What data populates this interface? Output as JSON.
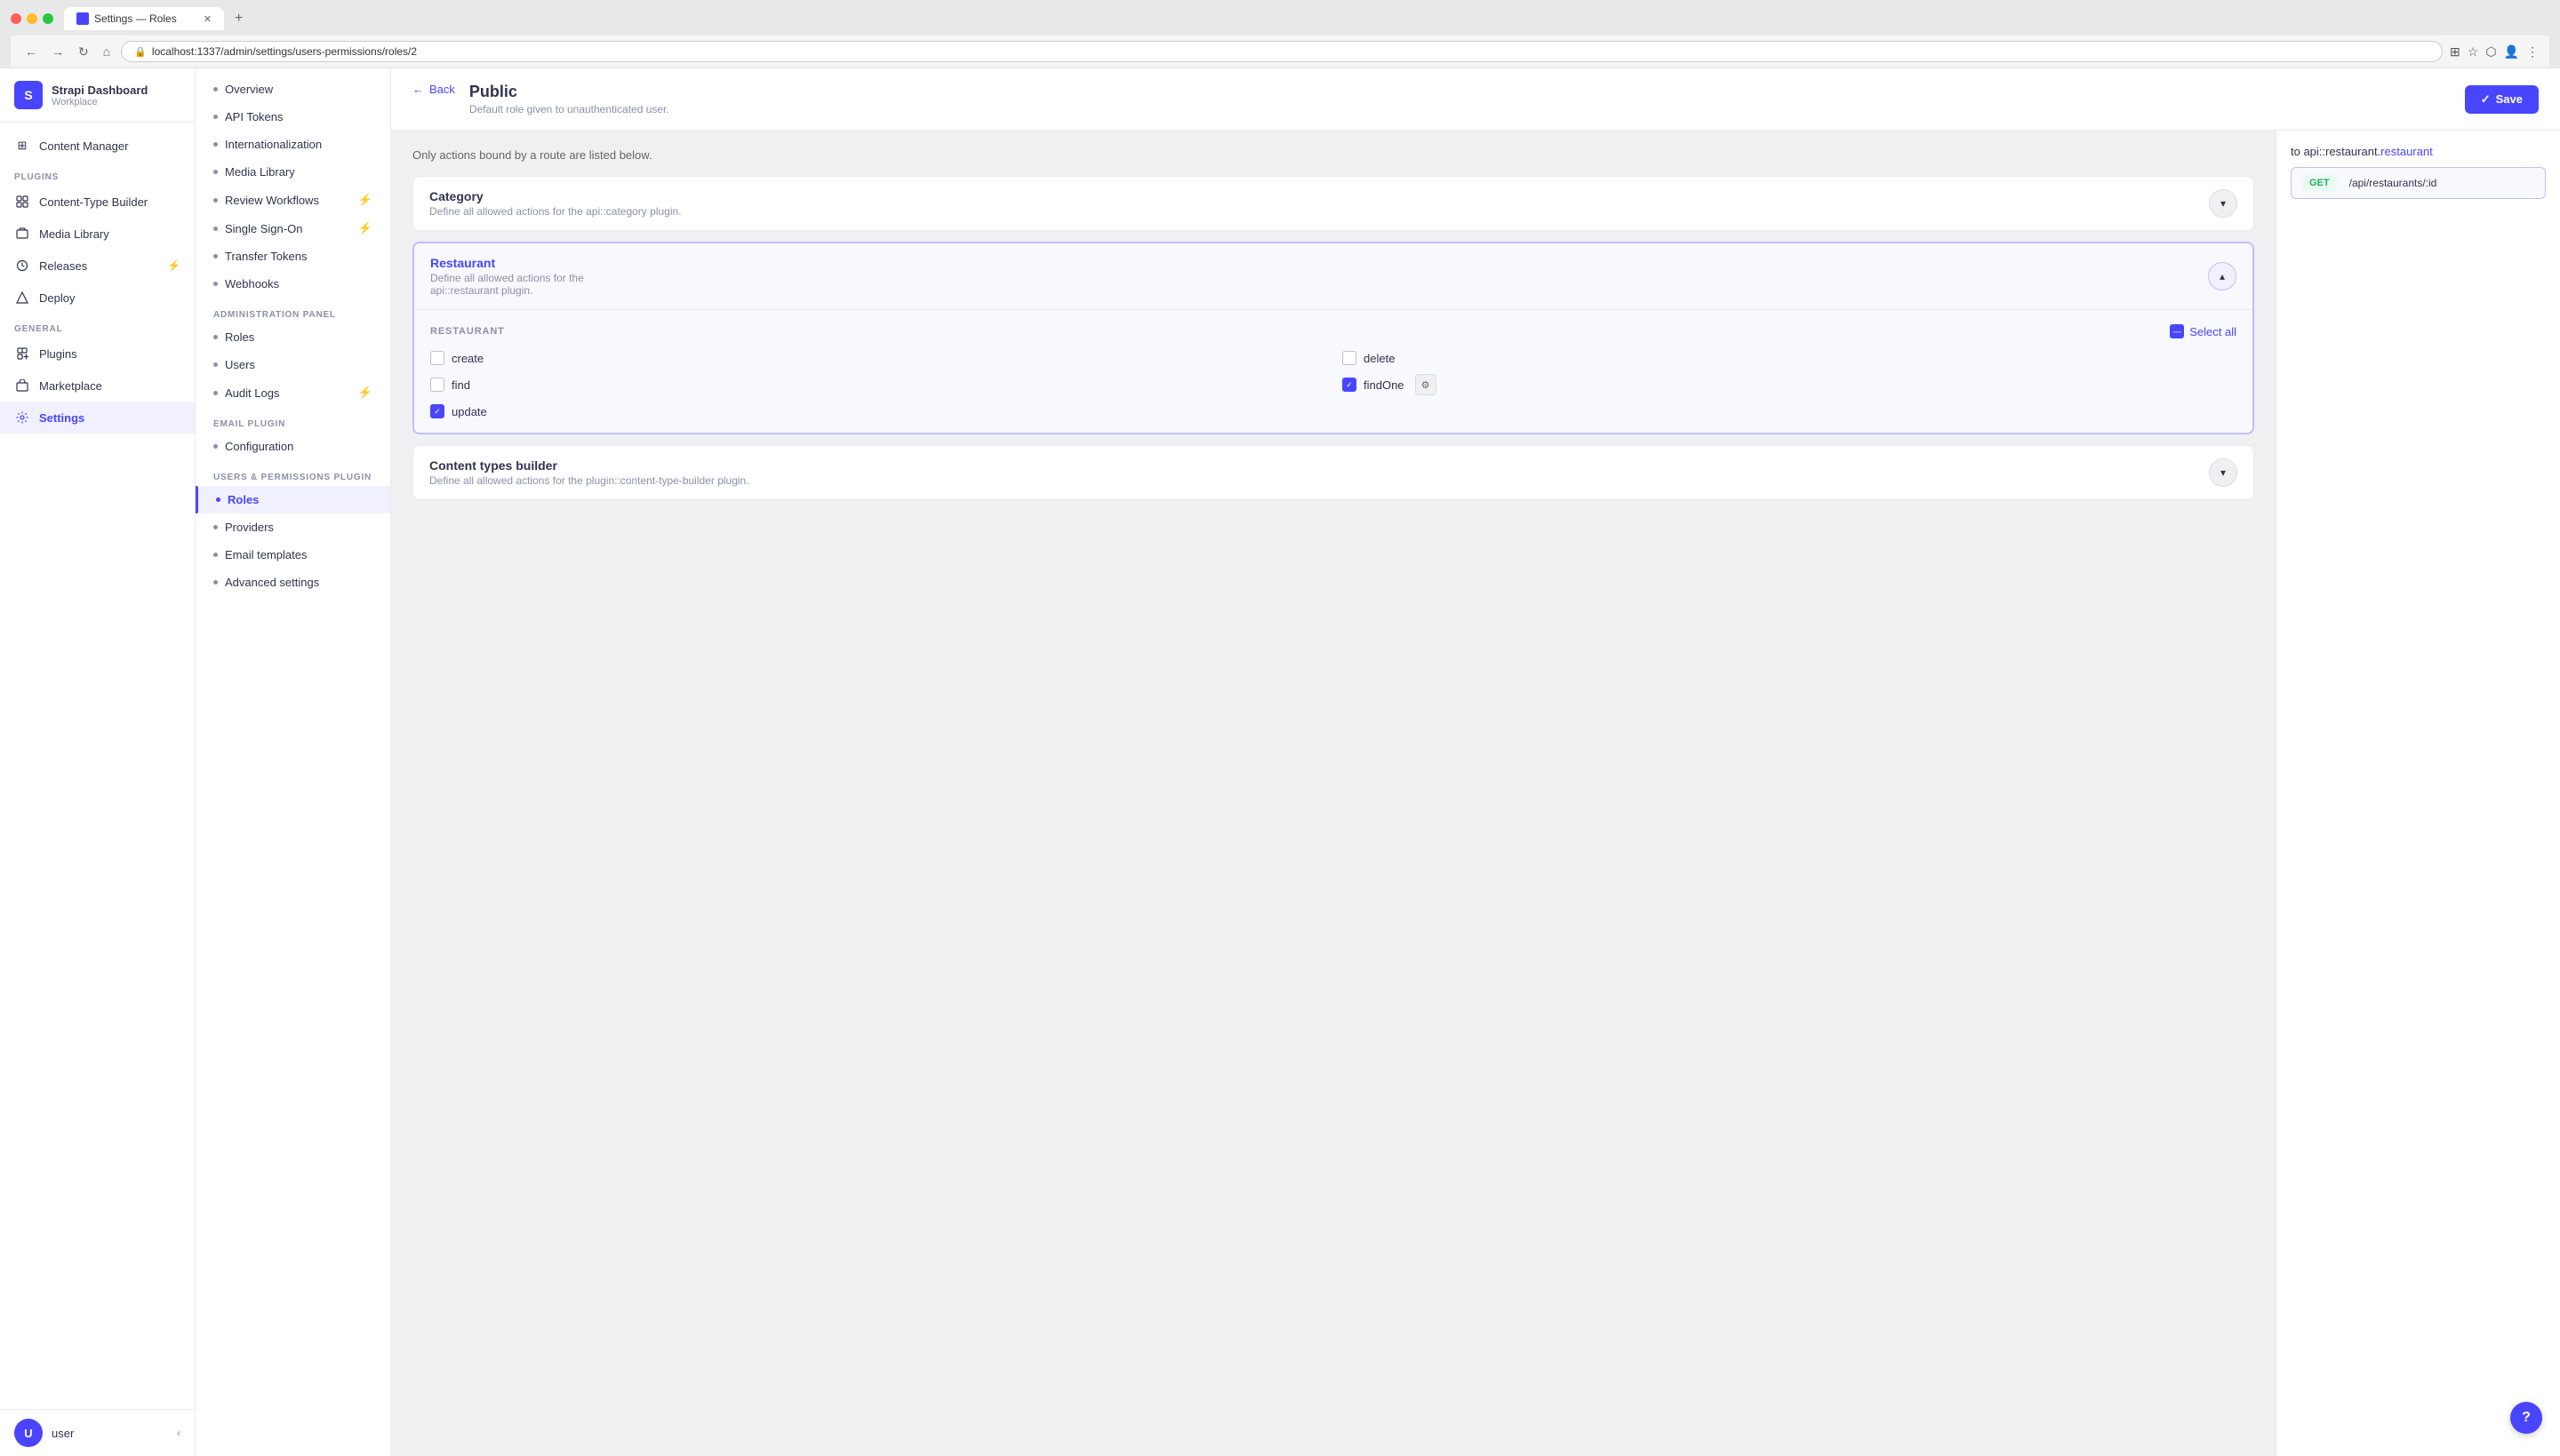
{
  "browser": {
    "tab_title": "Settings — Roles",
    "url": "localhost:1337/admin/settings/users-permissions/roles/2",
    "new_tab_label": "+"
  },
  "sidebar": {
    "brand_name": "Strapi Dashboard",
    "brand_sub": "Workplace",
    "brand_initials": "S",
    "nav_items": [
      {
        "id": "content-manager",
        "label": "Content Manager",
        "icon": "grid"
      },
      {
        "id": "plugins-section",
        "label": "PLUGINS",
        "type": "section"
      },
      {
        "id": "content-type-builder",
        "label": "Content-Type Builder",
        "icon": "builder"
      },
      {
        "id": "media-library",
        "label": "Media Library",
        "icon": "media"
      },
      {
        "id": "releases",
        "label": "Releases",
        "icon": "releases",
        "badge": "⚡"
      },
      {
        "id": "deploy",
        "label": "Deploy",
        "icon": "deploy"
      },
      {
        "id": "general-section",
        "label": "GENERAL",
        "type": "section"
      },
      {
        "id": "plugins",
        "label": "Plugins",
        "icon": "plugin"
      },
      {
        "id": "marketplace",
        "label": "Marketplace",
        "icon": "marketplace"
      },
      {
        "id": "settings",
        "label": "Settings",
        "icon": "settings",
        "active": true
      }
    ],
    "user_name": "user",
    "user_initial": "U"
  },
  "settings_sidebar": {
    "items_top": [
      {
        "id": "overview",
        "label": "Overview"
      },
      {
        "id": "api-tokens",
        "label": "API Tokens"
      },
      {
        "id": "internationalization",
        "label": "Internationalization"
      },
      {
        "id": "media-library",
        "label": "Media Library"
      },
      {
        "id": "review-workflows",
        "label": "Review Workflows",
        "badge": "⚡"
      },
      {
        "id": "single-sign-on",
        "label": "Single Sign-On",
        "badge": "⚡"
      },
      {
        "id": "transfer-tokens",
        "label": "Transfer Tokens"
      },
      {
        "id": "webhooks",
        "label": "Webhooks"
      }
    ],
    "section_admin": "ADMINISTRATION PANEL",
    "items_admin": [
      {
        "id": "roles",
        "label": "Roles"
      },
      {
        "id": "users",
        "label": "Users"
      },
      {
        "id": "audit-logs",
        "label": "Audit Logs",
        "badge": "⚡"
      }
    ],
    "section_email": "EMAIL PLUGIN",
    "items_email": [
      {
        "id": "configuration",
        "label": "Configuration"
      }
    ],
    "section_users": "USERS & PERMISSIONS PLUGIN",
    "items_users": [
      {
        "id": "roles-up",
        "label": "Roles",
        "active": true
      },
      {
        "id": "providers",
        "label": "Providers"
      },
      {
        "id": "email-templates",
        "label": "Email templates"
      },
      {
        "id": "advanced-settings",
        "label": "Advanced settings"
      }
    ]
  },
  "page": {
    "back_label": "Back",
    "title": "Public",
    "subtitle": "Default role given to unauthenticated user.",
    "save_label": "Save",
    "note": "Only actions bound by a route are listed below."
  },
  "plugins": [
    {
      "id": "category",
      "name": "Category",
      "desc": "Define all allowed actions for the api::category plugin.",
      "expanded": false
    },
    {
      "id": "restaurant",
      "name": "Restaurant",
      "desc": "Define all allowed actions for the api::restaurant plugin.",
      "expanded": true,
      "section_label": "RESTAURANT",
      "permissions": [
        {
          "id": "create",
          "label": "create",
          "checked": false
        },
        {
          "id": "delete",
          "label": "delete",
          "checked": false
        },
        {
          "id": "find",
          "label": "find",
          "checked": false
        },
        {
          "id": "findOne",
          "label": "findOne",
          "checked": true,
          "has_gear": true
        },
        {
          "id": "update",
          "label": "update",
          "checked": true
        }
      ],
      "select_all_label": "Select all"
    },
    {
      "id": "content-types-builder",
      "name": "Content types builder",
      "desc": "Define all allowed actions for the plugin::content-type-builder plugin.",
      "expanded": false
    }
  ],
  "right_panel": {
    "route_prefix": "to api::restaurant.",
    "route_link": "restaurant",
    "method": "GET",
    "method_color": "#27ae60",
    "path": "/api/restaurants/:id"
  },
  "colors": {
    "primary": "#4945ff",
    "accent_orange": "#f5a623",
    "success": "#27ae60"
  }
}
